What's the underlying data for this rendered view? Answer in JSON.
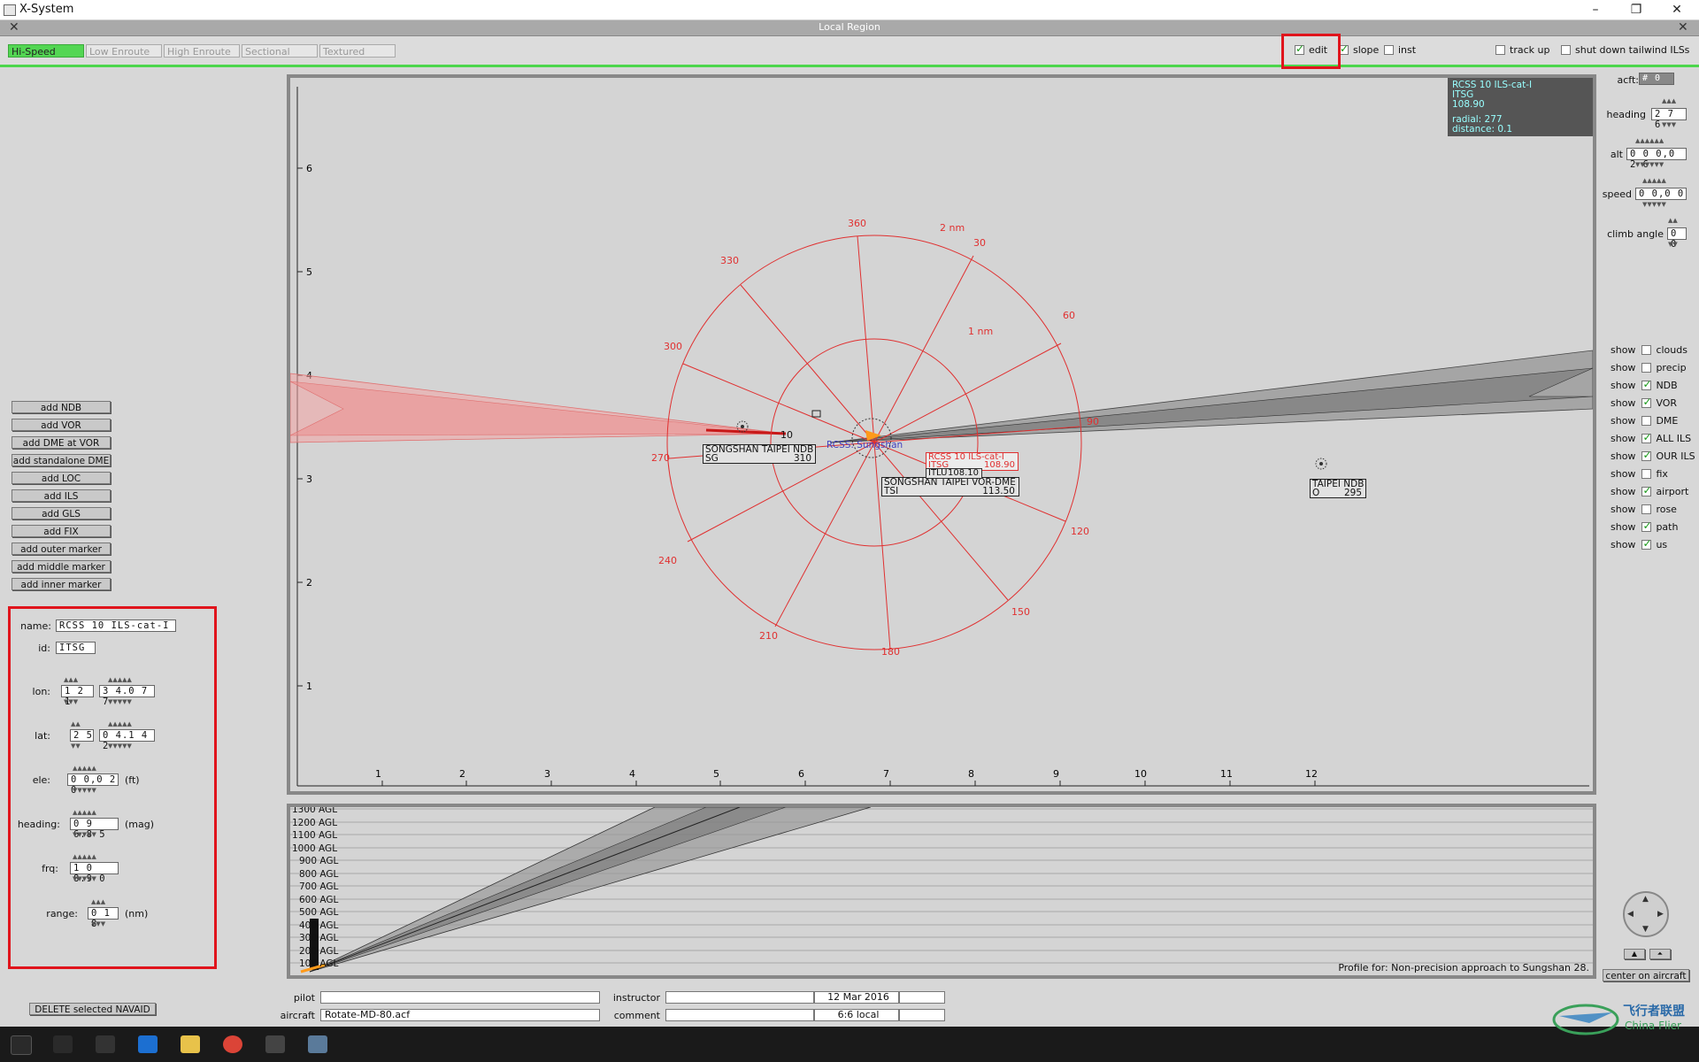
{
  "window": {
    "title": "X-System",
    "min": "–",
    "restore": "❐",
    "close": "✕"
  },
  "region": {
    "title": "Local Region",
    "close": "✕"
  },
  "tabs": [
    "Hi-Speed",
    "Low Enroute",
    "High Enroute",
    "Sectional",
    "Textured"
  ],
  "toolbar_checks": [
    {
      "label": "edit",
      "checked": true
    },
    {
      "label": "slope",
      "checked": true
    },
    {
      "label": "inst",
      "checked": false
    },
    {
      "label": "track up",
      "checked": false
    },
    {
      "label": "shut down tailwind ILSs",
      "checked": false
    }
  ],
  "left_buttons": [
    "add NDB",
    "add VOR",
    "add DME at VOR",
    "add standalone DME",
    "add LOC",
    "add ILS",
    "add GLS",
    "add FIX",
    "add outer marker",
    "add middle marker",
    "add inner marker"
  ],
  "props": {
    "name_label": "name:",
    "name": "RCSS 10  ILS-cat-I",
    "id_label": "id:",
    "id": "ITSG",
    "lon_label": "lon:",
    "lon_deg": "1 2 1",
    "lon_min": "3 4.0 7 7",
    "lat_label": "lat:",
    "lat_deg": "2 5",
    "lat_min": "0 4.1 4 2",
    "ele_label": "ele:",
    "ele": "0 0,0 2 0",
    "ele_unit": "(ft)",
    "heading_label": "heading:",
    "heading": "0 9 6.8 5",
    "heading_unit": "(mag)",
    "frq_label": "frq:",
    "frq": "1 0 8.9 0",
    "range_label": "range:",
    "range": "0 1 8",
    "range_unit": "(nm)"
  },
  "delete_button": "DELETE selected NAVAID",
  "map": {
    "y_ticks": [
      "6",
      "5",
      "4",
      "3",
      "2",
      "1"
    ],
    "x_ticks": [
      "1",
      "2",
      "3",
      "4",
      "5",
      "6",
      "7",
      "8",
      "9",
      "10",
      "11",
      "12"
    ],
    "compass": [
      "360",
      "30",
      "60",
      "90",
      "120",
      "150",
      "180",
      "210",
      "240",
      "270",
      "300",
      "330"
    ],
    "ring_labels": [
      "2 nm",
      "1 nm"
    ],
    "rwy_label": "10",
    "airport_label": "RCSS: Sungshan",
    "navaids": [
      {
        "name": "SONGSHAN TAIPEI NDB",
        "id": "SG",
        "freq": "310"
      },
      {
        "name": "SONGSHAN TAIPEI VOR-DME",
        "id": "TSI",
        "freq": "113.50"
      },
      {
        "name": "TAIPEI NDB",
        "id": "O",
        "freq": "295"
      }
    ],
    "ils_tag": {
      "line1": "RCSS 10  ILS-cat-I",
      "id": "ITSG",
      "freq": "108.90"
    },
    "ils2_tag": {
      "id": "ITLU",
      "freq": "108.10"
    },
    "info": {
      "line1": "RCSS 10  ILS-cat-I",
      "line2": "ITSG",
      "line3": "108.90",
      "line4": "radial: 277",
      "line5": "distance: 0.1"
    }
  },
  "aircraft_panel": {
    "acft_label": "acft:",
    "acft": "# 0",
    "heading_label": "heading",
    "heading": "2 7 6",
    "alt_label": "alt",
    "alt": "0 0 0,0 2 6",
    "speed_label": "speed",
    "speed": "0 0,0 0",
    "climb_label": "climb angle",
    "climb": "0 0"
  },
  "show_label": "show",
  "show_items": [
    {
      "label": "clouds",
      "checked": false
    },
    {
      "label": "precip",
      "checked": false
    },
    {
      "label": "NDB",
      "checked": true
    },
    {
      "label": "VOR",
      "checked": true
    },
    {
      "label": "DME",
      "checked": false
    },
    {
      "label": "ALL ILS",
      "checked": true
    },
    {
      "label": "OUR ILS",
      "checked": true
    },
    {
      "label": "fix",
      "checked": false
    },
    {
      "label": "airport",
      "checked": true
    },
    {
      "label": "rose",
      "checked": false
    },
    {
      "label": "path",
      "checked": true
    },
    {
      "label": "us",
      "checked": true
    }
  ],
  "profile": {
    "alt_ticks": [
      "1300 AGL",
      "1200 AGL",
      "1100 AGL",
      "1000 AGL",
      "900 AGL",
      "800 AGL",
      "700 AGL",
      "600 AGL",
      "500 AGL",
      "400 AGL",
      "300 AGL",
      "200 AGL",
      "100 AGL"
    ],
    "caption": "Profile for: Non-precision approach to Sungshan 28."
  },
  "center_button": "center on aircraft",
  "bottom": {
    "pilot_label": "pilot",
    "pilot": "",
    "aircraft_label": "aircraft",
    "aircraft": "Rotate-MD-80.acf",
    "instructor_label": "instructor",
    "instructor": "",
    "comment_label": "comment",
    "comment": "",
    "date": "12 Mar 2016",
    "time": "6:6 local"
  },
  "watermark": {
    "cn": "飞行者联盟",
    "en": "China Flier"
  },
  "colors": {
    "accent_green": "#4cd64c",
    "highlight_red": "#e0141c",
    "map_red": "#e03030",
    "info_cyan": "#99ffff"
  }
}
